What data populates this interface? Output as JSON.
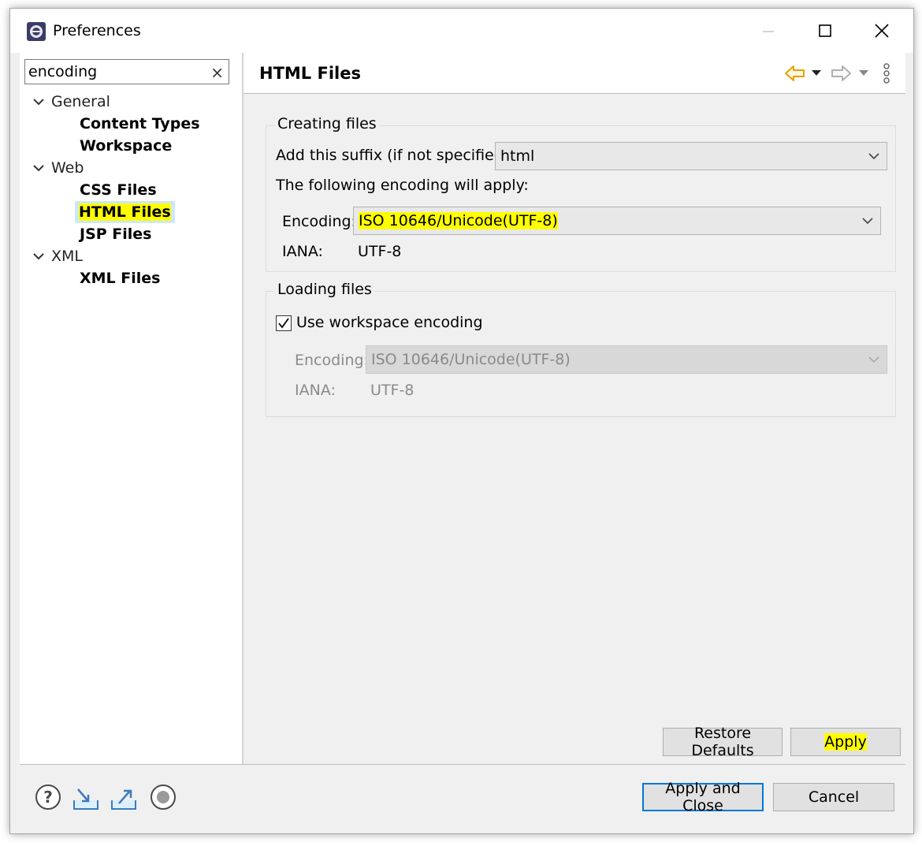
{
  "window": {
    "title": "Preferences"
  },
  "filter": {
    "value": "encoding",
    "clear_glyph": "×"
  },
  "tree": {
    "general": {
      "label": "General",
      "children": [
        "Content Types",
        "Workspace"
      ]
    },
    "web": {
      "label": "Web",
      "children": [
        "CSS Files",
        "HTML Files",
        "JSP Files"
      ]
    },
    "xml": {
      "label": "XML",
      "children": [
        "XML Files"
      ]
    }
  },
  "page": {
    "title": "HTML Files"
  },
  "creating": {
    "group_label": "Creating files",
    "suffix_label": "Add this suffix (if not specified):",
    "suffix_value": "html",
    "apply_note": "The following encoding will apply:",
    "encoding_label": "Encoding:",
    "encoding_value": "ISO 10646/Unicode(UTF-8)",
    "iana_label": "IANA:",
    "iana_value": "UTF-8"
  },
  "loading": {
    "group_label": "Loading files",
    "use_workspace_label": "Use workspace encoding",
    "use_workspace_checked": true,
    "encoding_label": "Encoding:",
    "encoding_value": "ISO 10646/Unicode(UTF-8)",
    "iana_label": "IANA:",
    "iana_value": "UTF-8"
  },
  "buttons": {
    "restore_defaults": "Restore Defaults",
    "apply": "Apply",
    "apply_and_close": "Apply and Close",
    "cancel": "Cancel"
  },
  "colors": {
    "highlight": "#ffff00",
    "selection": "#cce8ff",
    "accent": "#0078d7",
    "back_arrow": "#e8a000"
  }
}
